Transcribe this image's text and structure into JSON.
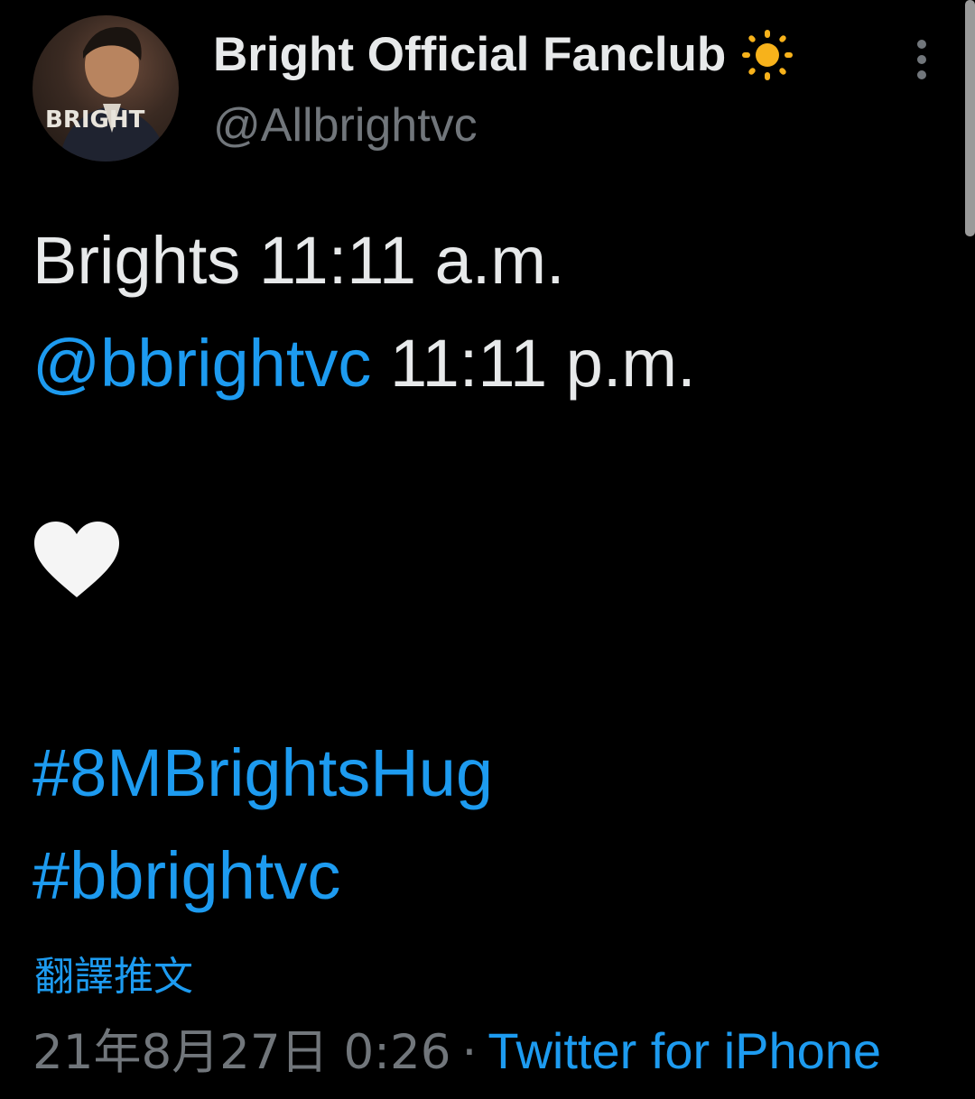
{
  "author": {
    "display_name": "Bright Official Fanclub",
    "handle": "@Allbrightvc",
    "avatar_text": "BRIGHT",
    "badge_icon": "sun-emoji-icon"
  },
  "tweet": {
    "line1": "Brights 11:11 a.m.",
    "mention": "@bbrightvc",
    "line2_rest": " 11:11 p.m.",
    "emoji": "white-heart-icon",
    "hashtags": [
      "#8MBrightsHug",
      "#bbrightvc"
    ]
  },
  "translate_label": "翻譯推文",
  "meta": {
    "date": "21年8月27日 0:26",
    "separator": "·",
    "source": "Twitter for iPhone"
  },
  "colors": {
    "background": "#000000",
    "text": "#e7e9ea",
    "secondary": "#71767b",
    "accent": "#1d9bf0",
    "sun": "#f7b21b"
  }
}
